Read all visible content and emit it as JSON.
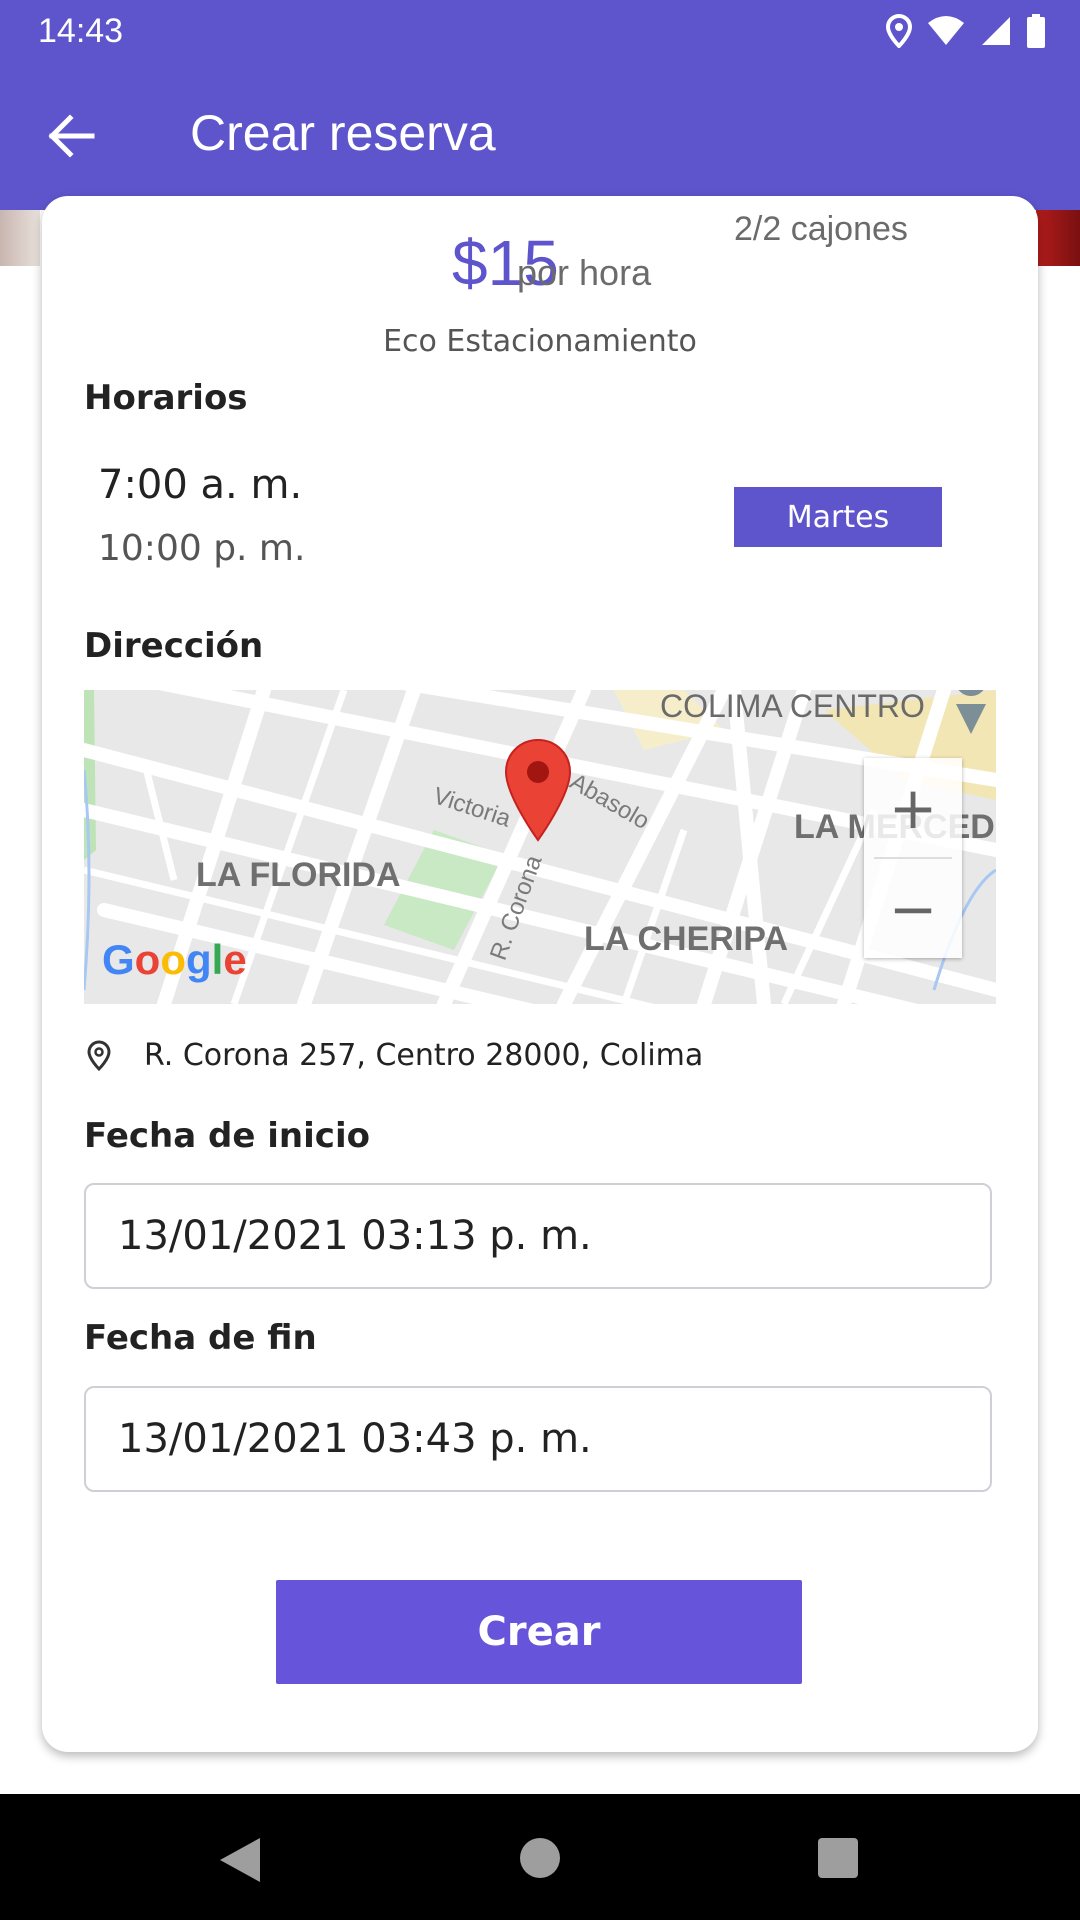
{
  "status": {
    "time": "14:43"
  },
  "appbar": {
    "title": "Crear reserva"
  },
  "listing": {
    "price": "$15",
    "price_unit": "por hora",
    "spaces": "2/2 cajones",
    "name": "Eco Estacionamiento"
  },
  "schedule": {
    "label": "Horarios",
    "start": "7:00 a. m.",
    "end": "10:00 p. m.",
    "day": "Martes"
  },
  "address": {
    "label": "Dirección",
    "text": "R. Corona 257, Centro 28000, Colima"
  },
  "map": {
    "labels": [
      "COLIMA CENTRO",
      "LA MERCED",
      "LA FLORIDA",
      "LA CHERIPA"
    ],
    "streets": [
      "Victoria",
      "Abasolo",
      "R. Corona"
    ],
    "provider": "Google",
    "zoom_in": "+",
    "zoom_out": "−"
  },
  "form": {
    "start_label": "Fecha de inicio",
    "start_value": "13/01/2021 03:13 p. m.",
    "end_label": "Fecha de fin",
    "end_value": "13/01/2021 03:43 p. m.",
    "submit": "Crear"
  },
  "colors": {
    "primary": "#5E55CD",
    "button": "#6655DB",
    "pin": "#EA4335"
  }
}
